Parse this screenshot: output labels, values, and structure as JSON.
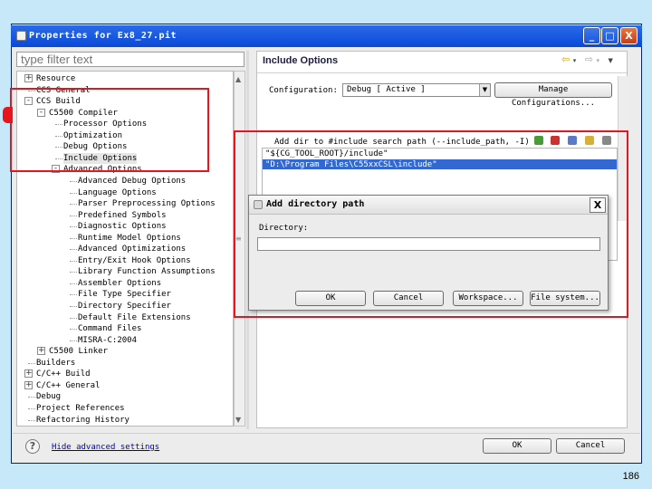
{
  "window": {
    "title": "Properties for Ex8_27.pit",
    "minimize": "_",
    "maximize": "□",
    "close": "X"
  },
  "filter": {
    "placeholder": "type filter text"
  },
  "tree": {
    "items": [
      {
        "label": "Resource",
        "expander": "+"
      },
      {
        "label": "CCS General",
        "expander": ""
      },
      {
        "label": "CCS Build",
        "expander": "-"
      },
      {
        "label": "C5500 Compiler",
        "expander": "-"
      },
      {
        "label": "Processor Options",
        "expander": ""
      },
      {
        "label": "Optimization",
        "expander": ""
      },
      {
        "label": "Debug Options",
        "expander": ""
      },
      {
        "label": "Include Options",
        "expander": ""
      },
      {
        "label": "Advanced Options",
        "expander": "-"
      },
      {
        "label": "Advanced Debug Options",
        "expander": ""
      },
      {
        "label": "Language Options",
        "expander": ""
      },
      {
        "label": "Parser Preprocessing Options",
        "expander": ""
      },
      {
        "label": "Predefined Symbols",
        "expander": ""
      },
      {
        "label": "Diagnostic Options",
        "expander": ""
      },
      {
        "label": "Runtime Model Options",
        "expander": ""
      },
      {
        "label": "Advanced Optimizations",
        "expander": ""
      },
      {
        "label": "Entry/Exit Hook Options",
        "expander": ""
      },
      {
        "label": "Library Function Assumptions",
        "expander": ""
      },
      {
        "label": "Assembler Options",
        "expander": ""
      },
      {
        "label": "File Type Specifier",
        "expander": ""
      },
      {
        "label": "Directory Specifier",
        "expander": ""
      },
      {
        "label": "Default File Extensions",
        "expander": ""
      },
      {
        "label": "Command Files",
        "expander": ""
      },
      {
        "label": "MISRA-C:2004",
        "expander": ""
      },
      {
        "label": "C5500 Linker",
        "expander": "+"
      },
      {
        "label": "Builders",
        "expander": ""
      },
      {
        "label": "C/C++ Build",
        "expander": "+"
      },
      {
        "label": "C/C++ General",
        "expander": "+"
      },
      {
        "label": "Debug",
        "expander": ""
      },
      {
        "label": "Project References",
        "expander": ""
      },
      {
        "label": "Refactoring History",
        "expander": ""
      }
    ]
  },
  "panel": {
    "title": "Include Options",
    "back_icon": "⇦",
    "forward_icon": "⇨",
    "configuration_label": "Configuration:",
    "configuration_value": "Debug  [ Active ]",
    "manage_button": "Manage Configurations...",
    "include_label": "Add dir to #include search path (--include_path, -I)",
    "include_paths": [
      "\"${CG_TOOL_ROOT}/include\"",
      "\"D:\\Program Files\\C55xxCSL\\include\""
    ]
  },
  "dialog": {
    "title": "Add directory path",
    "close": "X",
    "directory_label": "Directory:",
    "directory_value": "",
    "ok": "OK",
    "cancel": "Cancel",
    "workspace": "Workspace...",
    "filesystem": "File system..."
  },
  "footer": {
    "help_icon": "?",
    "link": "Hide advanced settings",
    "ok": "OK",
    "cancel": "Cancel"
  },
  "page_number": "186",
  "colors": {
    "highlight": "#e8141e",
    "selection": "#3268d0",
    "titlebar": "#0a48d8"
  }
}
